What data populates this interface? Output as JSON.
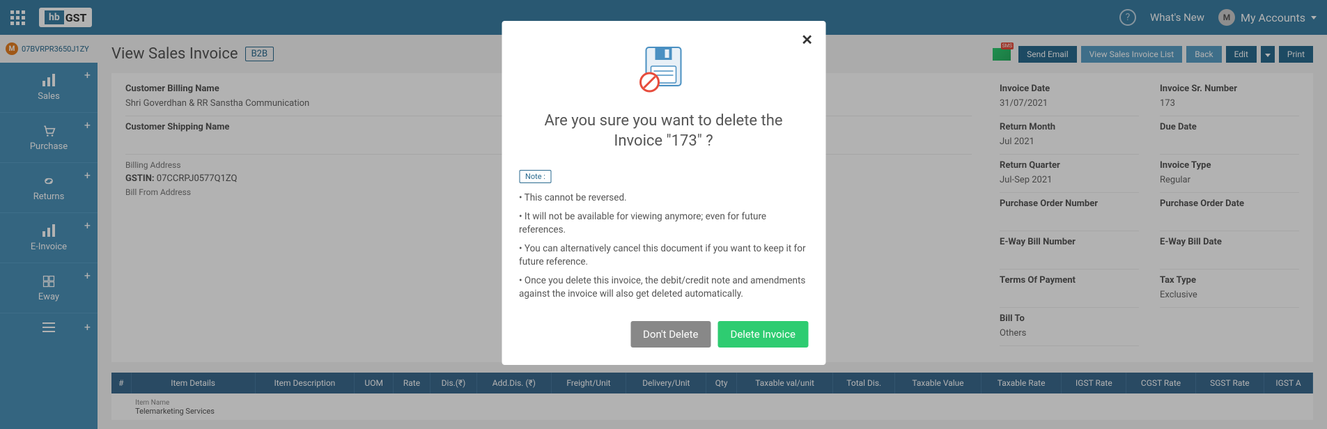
{
  "header": {
    "whats_new": "What's New",
    "account_label": "My Accounts",
    "avatar_letter": "M"
  },
  "org": {
    "badge_letter": "M",
    "id": "07BVRPR3650J1ZY"
  },
  "sidebar": {
    "items": [
      {
        "label": "Sales"
      },
      {
        "label": "Purchase"
      },
      {
        "label": "Returns"
      },
      {
        "label": "E-Invoice"
      },
      {
        "label": "Eway"
      }
    ]
  },
  "page": {
    "title": "View Sales Invoice",
    "badge": "B2B"
  },
  "actions": {
    "send_email": "Send Email",
    "view_list": "View Sales Invoice List",
    "back": "Back",
    "edit": "Edit",
    "print": "Print"
  },
  "invoice": {
    "billing_name_label": "Customer Billing Name",
    "billing_name": "Shri Goverdhan & RR Sanstha Communication",
    "shipping_name_label": "Customer Shipping Name",
    "billing_address_label": "Billing Address",
    "gstin_label": "GSTIN:",
    "gstin": "07CCRPJ0577Q1ZQ",
    "bill_from_label": "Bill From Address",
    "right_col1": [
      {
        "label": "Invoice Date",
        "value": "31/07/2021"
      },
      {
        "label": "Return Month",
        "value": "Jul 2021"
      },
      {
        "label": "Return Quarter",
        "value": "Jul-Sep 2021"
      },
      {
        "label": "Purchase Order Number",
        "value": ""
      },
      {
        "label": "E-Way Bill Number",
        "value": ""
      },
      {
        "label": "Terms Of Payment",
        "value": ""
      },
      {
        "label": "Bill To",
        "value": "Others"
      }
    ],
    "right_col2": [
      {
        "label": "Invoice Sr. Number",
        "value": "173"
      },
      {
        "label": "Due Date",
        "value": ""
      },
      {
        "label": "Invoice Type",
        "value": "Regular"
      },
      {
        "label": "Purchase Order Date",
        "value": ""
      },
      {
        "label": "E-Way Bill Date",
        "value": ""
      },
      {
        "label": "Tax Type",
        "value": "Exclusive"
      }
    ]
  },
  "table": {
    "headers": [
      "#",
      "Item Details",
      "Item Description",
      "UOM",
      "Rate",
      "Dis.(₹)",
      "Add.Dis. (₹)",
      "Freight/Unit",
      "Delivery/Unit",
      "Qty",
      "Taxable val/unit",
      "Total Dis.",
      "Taxable Value",
      "Taxable Rate",
      "IGST Rate",
      "CGST Rate",
      "SGST Rate",
      "IGST A"
    ],
    "item_name_label": "Item Name",
    "row1_item": "Telemarketing Services"
  },
  "modal": {
    "title": "Are you sure you want to delete the Invoice \"173\" ?",
    "note_label": "Note :",
    "notes": [
      "• This cannot be reversed.",
      "• It will not be available for viewing anymore; even for future references.",
      "• You can alternatively cancel this document if you want to keep it for future reference.",
      "• Once you delete this invoice, the debit/credit note and amendments against the invoice will also get deleted automatically."
    ],
    "dont_delete": "Don't Delete",
    "delete": "Delete Invoice"
  }
}
